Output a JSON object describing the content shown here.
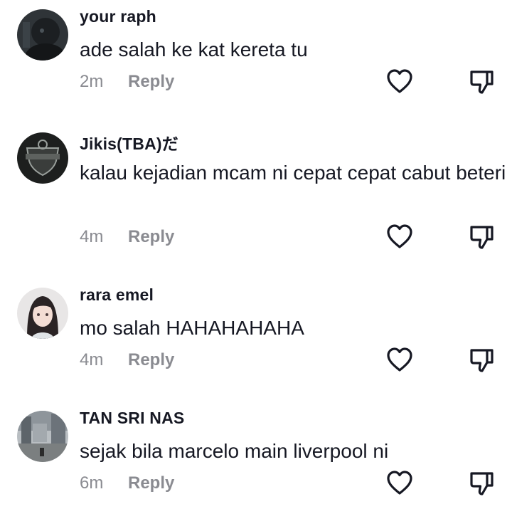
{
  "comments": [
    {
      "username": "your raph",
      "text": "ade salah ke kat kereta tu",
      "time": "2m",
      "reply": "Reply",
      "avatar_icon": "dark-portrait-avatar"
    },
    {
      "username": "Jikis(TBA)だ",
      "text": "kalau kejadian mcam ni cepat cepat cabut beteri",
      "time": "4m",
      "reply": "Reply",
      "avatar_icon": "shield-logo-avatar"
    },
    {
      "username": "rara emel",
      "text": "mo salah HAHAHAHAHA",
      "time": "4m",
      "reply": "Reply",
      "avatar_icon": "anime-girl-avatar"
    },
    {
      "username": "TAN SRI NAS",
      "text": "sejak bila marcelo main liverpool ni",
      "time": "6m",
      "reply": "Reply",
      "avatar_icon": "city-photo-avatar"
    }
  ],
  "icons": {
    "like": "heart-outline-icon",
    "dislike": "thumbs-down-outline-icon"
  },
  "colors": {
    "text": "#161823",
    "muted": "#8a8b91",
    "icon": "#161823"
  }
}
